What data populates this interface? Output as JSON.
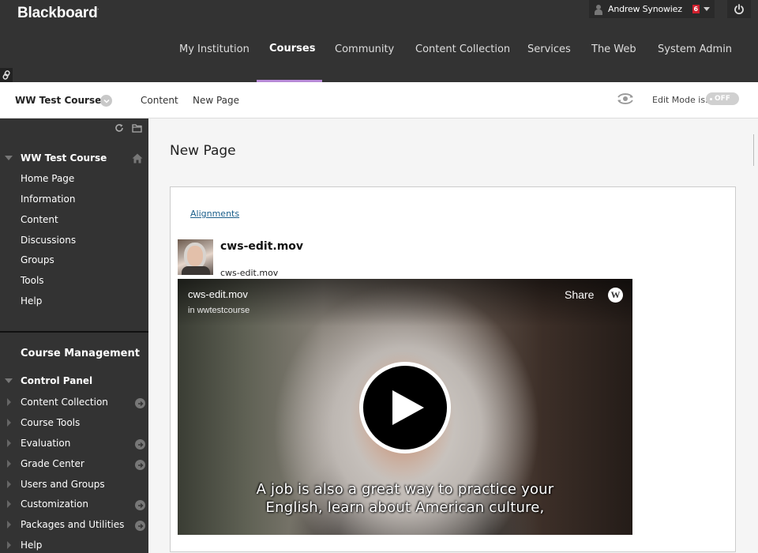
{
  "header": {
    "logo": "Blackboard",
    "user": {
      "name": "Andrew Synowiez",
      "notification_count": "6"
    },
    "nav": [
      {
        "label": "My Institution",
        "active": false
      },
      {
        "label": "Courses",
        "active": true
      },
      {
        "label": "Community",
        "active": false
      },
      {
        "label": "Content Collection",
        "active": false
      },
      {
        "label": "Services",
        "active": false
      },
      {
        "label": "The Web",
        "active": false
      },
      {
        "label": "System Admin",
        "active": false
      }
    ],
    "accent_color": "#b78ad6"
  },
  "breadcrumb": {
    "course": "WW Test Course",
    "items": [
      "Content",
      "New Page"
    ],
    "edit_mode_label": "Edit Mode is:",
    "edit_mode_value": "OFF"
  },
  "sidebar": {
    "course_title": "WW Test Course",
    "course_menu": [
      "Home Page",
      "Information",
      "Content",
      "Discussions",
      "Groups",
      "Tools",
      "Help"
    ],
    "management_title": "Course Management",
    "control_panel_title": "Control Panel",
    "control_panel": [
      {
        "label": "Content Collection",
        "has_arrow": true
      },
      {
        "label": "Course Tools",
        "has_arrow": false
      },
      {
        "label": "Evaluation",
        "has_arrow": true
      },
      {
        "label": "Grade Center",
        "has_arrow": true
      },
      {
        "label": "Users and Groups",
        "has_arrow": false
      },
      {
        "label": "Customization",
        "has_arrow": true
      },
      {
        "label": "Packages and Utilities",
        "has_arrow": true
      },
      {
        "label": "Help",
        "has_arrow": false
      }
    ]
  },
  "main": {
    "title": "New Page",
    "alignments_link": "Alignments",
    "item": {
      "title": "cws-edit.mov",
      "subtitle": "cws-edit.mov"
    },
    "video": {
      "title": "cws-edit.mov",
      "source": "in wwtestcourse",
      "share_label": "Share",
      "logo_letter": "W",
      "caption_lines": [
        "A job is also a great way to practice your",
        "English, learn about American culture,"
      ]
    }
  }
}
